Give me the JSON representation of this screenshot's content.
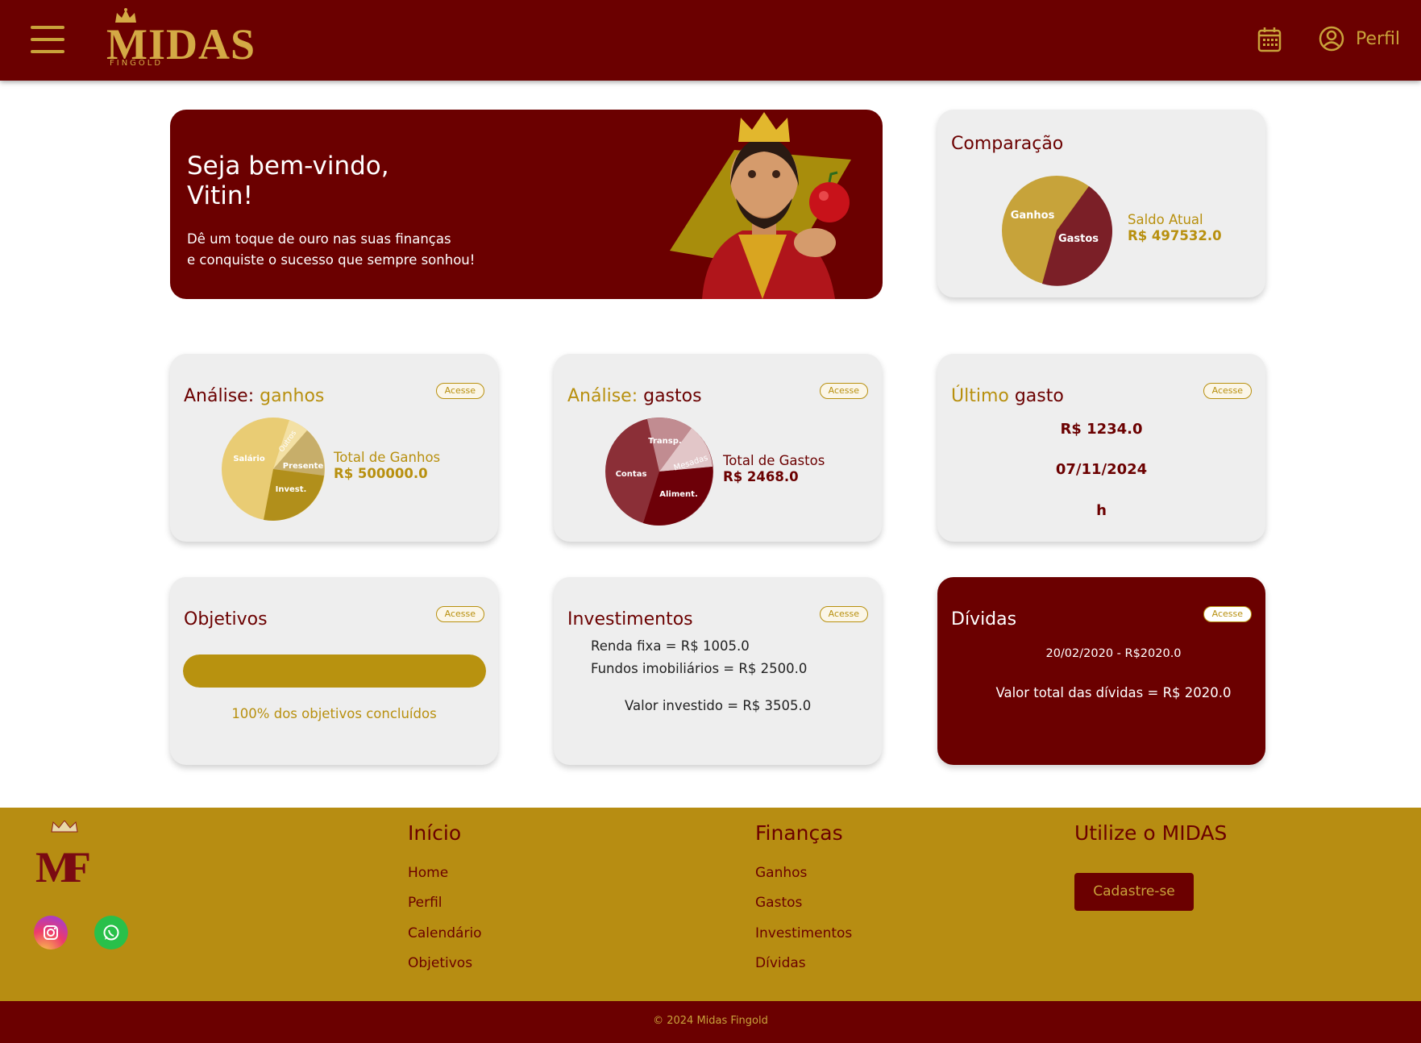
{
  "header": {
    "logo_text": "MIDAS",
    "logo_sub": "FINGOLD",
    "profile_label": "Perfil"
  },
  "welcome": {
    "title_line1": "Seja bem-vindo,",
    "title_line2": "Vitin!",
    "text_line1": "Dê um toque de ouro nas suas finanças",
    "text_line2": "e conquiste o sucesso que sempre sonhou!"
  },
  "comparacao": {
    "title": "Comparação",
    "slice_ganhos": "Ganhos",
    "slice_gastos": "Gastos",
    "saldo_label": "Saldo Atual",
    "saldo_value": "R$ 497532.0"
  },
  "ganhos": {
    "title_a": "Análise: ",
    "title_b": "ganhos",
    "access": "Acesse",
    "slices": [
      "Salário",
      "Outros",
      "Presente",
      "Invest."
    ],
    "total_label": "Total de Ganhos",
    "total_value": "R$ 500000.0"
  },
  "gastos": {
    "title_a": "Análise: ",
    "title_b": "gastos",
    "access": "Acesse",
    "slices": [
      "Transp.",
      "Mesadas",
      "Aliment.",
      "Contas"
    ],
    "total_label": "Total de Gastos",
    "total_value": "R$ 2468.0"
  },
  "ultimo": {
    "title_a": "Último ",
    "title_b": "gasto",
    "access": "Acesse",
    "value": "R$ 1234.0",
    "date": "07/11/2024",
    "time": "h"
  },
  "objetivos": {
    "title": "Objetivos",
    "access": "Acesse",
    "progress": 1.0,
    "caption": "100% dos objetivos concluídos"
  },
  "investimentos": {
    "title": "Investimentos",
    "access": "Acesse",
    "line1": "Renda fixa = R$ 1005.0",
    "line2": "Fundos imobiliários = R$ 2500.0",
    "total": "Valor investido = R$ 3505.0"
  },
  "dividas": {
    "title": "Dívidas",
    "access": "Acesse",
    "item": "20/02/2020 - R$2020.0",
    "total": "Valor total das dívidas = R$ 2020.0"
  },
  "footer": {
    "inicio_title": "Início",
    "inicio_links": [
      "Home",
      "Perfil",
      "Calendário",
      "Objetivos"
    ],
    "financas_title": "Finanças",
    "financas_links": [
      "Ganhos",
      "Gastos",
      "Investimentos",
      "Dívidas"
    ],
    "utilize_title": "Utilize o MIDAS",
    "cadastro_button": "Cadastre-se",
    "copyright": "© 2024 Midas Fingold"
  },
  "colors": {
    "brand_dark_red": "#6b0000",
    "brand_gold": "#b78d12",
    "card_bg": "#eeeeee"
  }
}
